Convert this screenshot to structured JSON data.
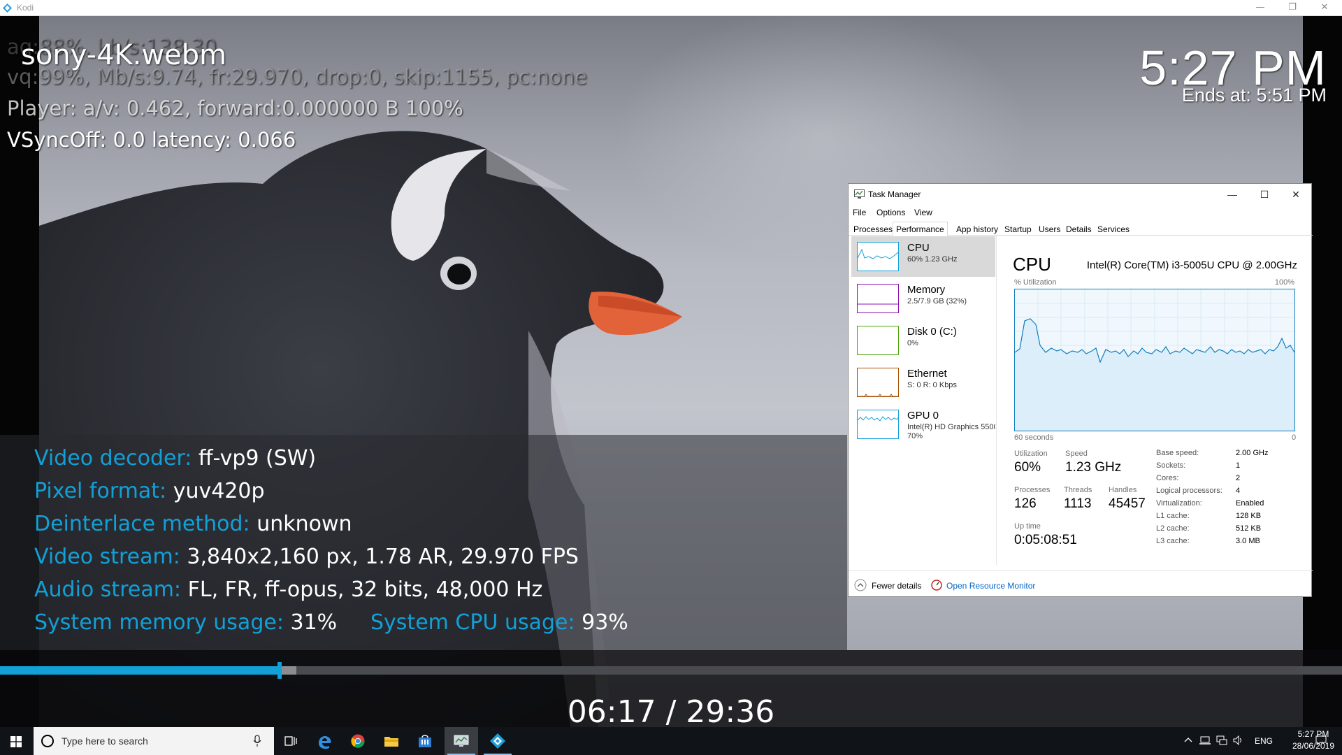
{
  "kodi_window": {
    "title": "Kodi",
    "controls": {
      "minimize": "—",
      "restore": "❐",
      "close": "✕"
    }
  },
  "osd": {
    "file_title": "sony-4K.webm",
    "debug_lines": [
      "aq:88%, kb/s:138.30",
      "vq:99%, Mb/s:9.74, fr:29.970, drop:0, skip:1155, pc:none",
      "Player: a/v: 0.462,  forward:0.000000 B 100%",
      "VSyncOff: 0.0 latency: 0.066"
    ],
    "clock": "5:27 PM",
    "ends_at": "Ends at: 5:51 PM"
  },
  "info": {
    "video_decoder": {
      "label": "Video decoder:",
      "value": "ff-vp9 (SW)"
    },
    "pixel_format": {
      "label": "Pixel format:",
      "value": "yuv420p"
    },
    "deinterlace": {
      "label": "Deinterlace method:",
      "value": "unknown"
    },
    "video_stream": {
      "label": "Video stream:",
      "value": "3,840x2,160 px, 1.78 AR, 29.970 FPS"
    },
    "audio_stream": {
      "label": "Audio stream:",
      "value": "FL, FR, ff-opus, 32 bits, 48,000 Hz"
    },
    "sys_memory": {
      "label": "System memory usage:",
      "value": "31%"
    },
    "sys_cpu": {
      "label": "System CPU usage:",
      "value": "93%"
    }
  },
  "player": {
    "progress": 0.2086,
    "timecode": "06:17 / 29:36",
    "accent": "#12a0d7"
  },
  "task_manager": {
    "title": "Task Manager",
    "menu": [
      "File",
      "Options",
      "View"
    ],
    "tabs": [
      "Processes",
      "Performance",
      "App history",
      "Startup",
      "Users",
      "Details",
      "Services"
    ],
    "active_tab": "Performance",
    "resources": [
      {
        "name": "CPU",
        "sub": "60%  1.23 GHz",
        "color": "#17a0d7"
      },
      {
        "name": "Memory",
        "sub": "2.5/7.9 GB (32%)",
        "color": "#8b12ae"
      },
      {
        "name": "Disk 0 (C:)",
        "sub": "0%",
        "color": "#4da60c"
      },
      {
        "name": "Ethernet",
        "sub": "S: 0 R: 0 Kbps",
        "color": "#a74f01"
      },
      {
        "name": "GPU 0",
        "sub": "Intel(R) HD Graphics 5500",
        "sub2": "70%",
        "color": "#17a0d7"
      }
    ],
    "cpu_panel": {
      "title": "CPU",
      "model": "Intel(R) Core(TM) i3-5005U CPU @ 2.00GHz",
      "y_label": "% Utilization",
      "y_max": "100%",
      "x_left": "60 seconds",
      "x_right": "0",
      "utilization_label": "Utilization",
      "utilization": "60%",
      "speed_label": "Speed",
      "speed": "1.23 GHz",
      "processes_label": "Processes",
      "processes": "126",
      "threads_label": "Threads",
      "threads": "1113",
      "handles_label": "Handles",
      "handles": "45457",
      "uptime_label": "Up time",
      "uptime": "0:05:08:51",
      "specs": [
        {
          "k": "Base speed:",
          "v": "2.00 GHz"
        },
        {
          "k": "Sockets:",
          "v": "1"
        },
        {
          "k": "Cores:",
          "v": "2"
        },
        {
          "k": "Logical processors:",
          "v": "4"
        },
        {
          "k": "Virtualization:",
          "v": "Enabled"
        },
        {
          "k": "L1 cache:",
          "v": "128 KB"
        },
        {
          "k": "L2 cache:",
          "v": "512 KB"
        },
        {
          "k": "L3 cache:",
          "v": "3.0 MB"
        }
      ]
    },
    "footer": {
      "fewer": "Fewer details",
      "resource_monitor": "Open Resource Monitor"
    }
  },
  "taskbar": {
    "search_placeholder": "Type here to search",
    "language": "ENG",
    "time": "5:27 PM",
    "date": "28/06/2019"
  }
}
